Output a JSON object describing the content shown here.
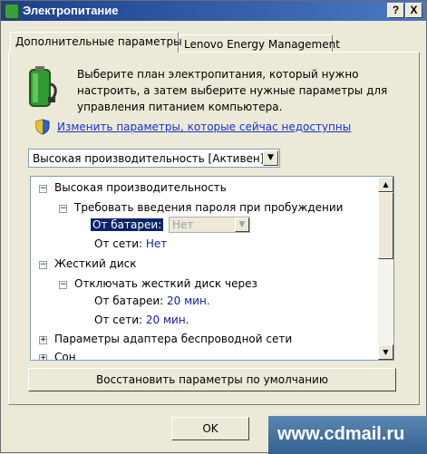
{
  "window": {
    "title": "Электропитание",
    "help_glyph": "?",
    "close_glyph": "X"
  },
  "tabs": [
    {
      "label": "Дополнительные параметры",
      "active": true
    },
    {
      "label": "Lenovo Energy Management",
      "active": false
    }
  ],
  "description": "Выберите план электропитания, который нужно настроить, а затем выберите нужные параметры для управления питанием компьютера.",
  "change_link": "Изменить параметры, которые сейчас недоступны",
  "plan_select": {
    "value": "Высокая производительность [Активен]"
  },
  "tree": {
    "plan_name": "Высокая производительность",
    "password_setting": "Требовать введения пароля при пробуждении",
    "on_battery_label": "От батареи:",
    "on_battery_value": "Нет",
    "on_ac_label": "От сети:",
    "on_ac_value": "Нет",
    "hard_disk": "Жесткий диск",
    "disk_off": "Отключать жесткий диск через",
    "disk_battery_label": "От батареи:",
    "disk_battery_value": "20 мин.",
    "disk_ac_label": "От сети:",
    "disk_ac_value": "20 мин.",
    "wireless": "Параметры адаптера беспроводной сети",
    "sleep": "Сон"
  },
  "restore_button": "Восстановить параметры по умолчанию",
  "ok_button": "OK",
  "watermark": "www.cdmail.ru",
  "colors": {
    "link": "#1a33c8",
    "value": "#10239e",
    "selection": "#0a246a"
  }
}
